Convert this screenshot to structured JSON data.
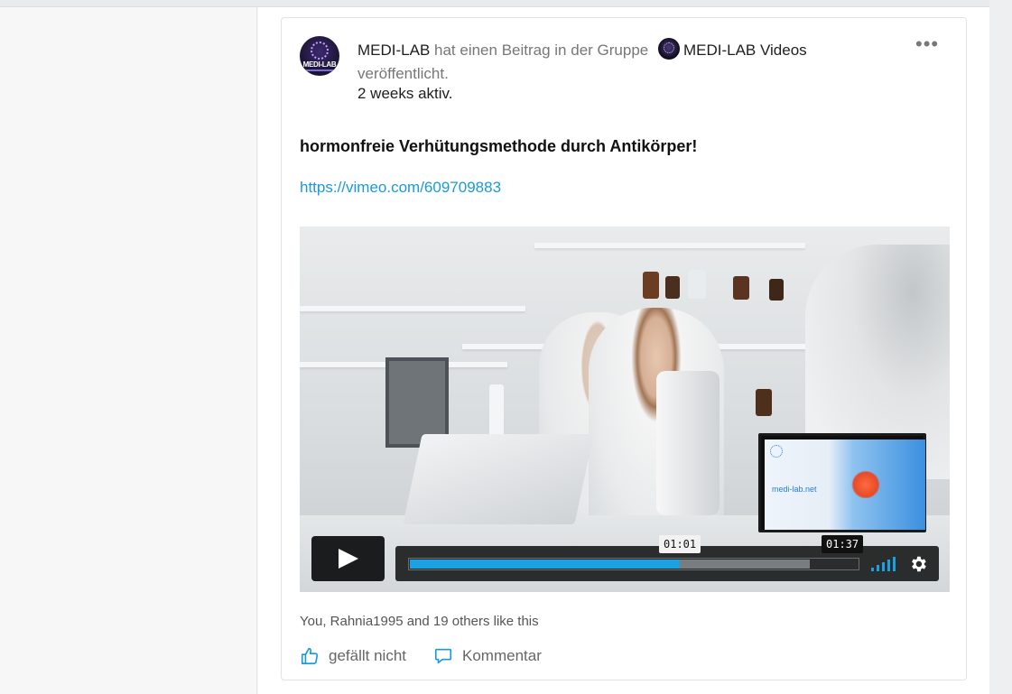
{
  "post": {
    "actor": "MEDI-LAB",
    "action_text": " hat einen Beitrag in der Gruppe ",
    "group_name": "MEDI-LAB Videos",
    "action_suffix": "veröffentlicht.",
    "activity": "2 weeks aktiv.",
    "more_label": "•••",
    "avatar_text": "MEDI-LAB",
    "title": "hormonfreie Verhütungsmethode durch Antikörper!",
    "link": "https://vimeo.com/609709883"
  },
  "video": {
    "current_time": "01:01",
    "hover_time": "01:37",
    "played_fraction": 0.6,
    "loaded_fraction": 0.89,
    "volume_bars": 5,
    "thumbnail_text": "medi-lab.net",
    "thumbnail_logo_text": "MEDI-LAB",
    "icons": [
      "play-icon",
      "volume-icon",
      "gear-icon"
    ]
  },
  "reactions": {
    "likes_text": "You, Rahnia1995 and 19 others like this",
    "like_label": "gefällt nicht",
    "comment_label": "Kommentar"
  },
  "colors": {
    "link": "#1a9bd7",
    "accent": "#1ba1e2",
    "text": "#1e1e1e",
    "muted": "#777777"
  }
}
